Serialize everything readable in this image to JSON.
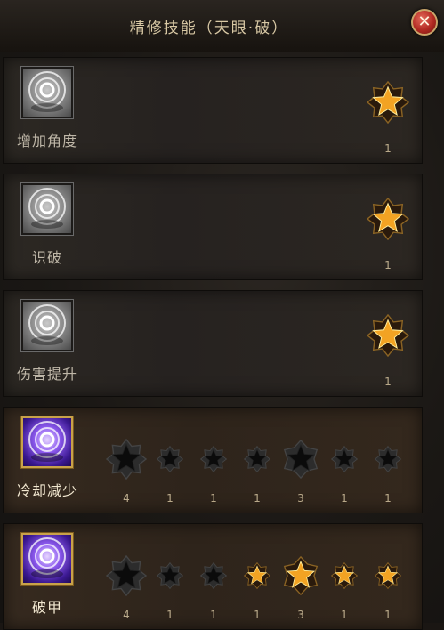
{
  "window": {
    "title": "精修技能（天眼·破）",
    "close_icon": "close-icon"
  },
  "colors": {
    "star_active": "#f2a323",
    "star_inactive": "#0b0b0b",
    "icon_grey": "#8b8b8b",
    "icon_purple": "#8e5bf0",
    "close_red": "#b22a22"
  },
  "skills": [
    {
      "name": "增加角度",
      "state": "locked",
      "icon": "eye-orb-icon",
      "stars": [
        {
          "level": "1",
          "active": true
        }
      ]
    },
    {
      "name": "识破",
      "state": "locked",
      "icon": "eye-orb-icon",
      "stars": [
        {
          "level": "1",
          "active": true
        }
      ]
    },
    {
      "name": "伤害提升",
      "state": "locked",
      "icon": "eye-orb-icon",
      "stars": [
        {
          "level": "1",
          "active": true
        }
      ]
    },
    {
      "name": "冷却减少",
      "state": "active",
      "icon": "eye-orb-icon",
      "stars": [
        {
          "level": "4",
          "active": false
        },
        {
          "level": "1",
          "active": false
        },
        {
          "level": "1",
          "active": false
        },
        {
          "level": "1",
          "active": false
        },
        {
          "level": "3",
          "active": false
        },
        {
          "level": "1",
          "active": false
        },
        {
          "level": "1",
          "active": false
        }
      ]
    },
    {
      "name": "破甲",
      "state": "active",
      "icon": "eye-orb-icon",
      "stars": [
        {
          "level": "4",
          "active": false
        },
        {
          "level": "1",
          "active": false
        },
        {
          "level": "1",
          "active": false
        },
        {
          "level": "1",
          "active": true
        },
        {
          "level": "3",
          "active": true
        },
        {
          "level": "1",
          "active": true
        },
        {
          "level": "1",
          "active": true
        }
      ]
    }
  ]
}
